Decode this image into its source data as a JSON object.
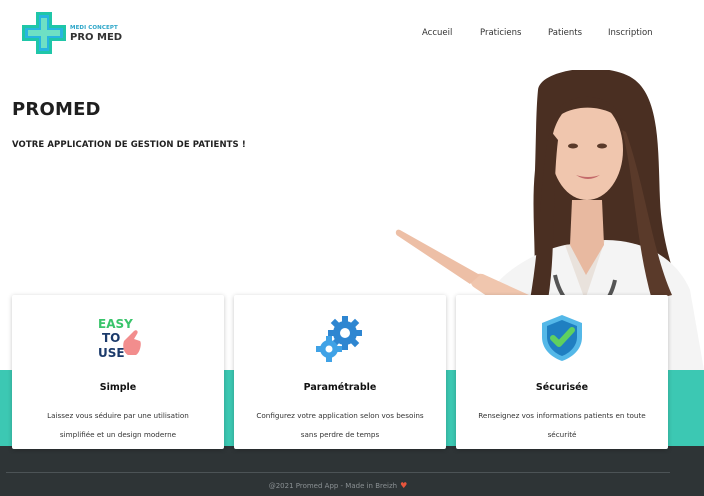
{
  "header": {
    "logo_subtitle": "MEDI CONCEPT",
    "logo_name": "PRO MED",
    "nav": [
      "Accueil",
      "Praticiens",
      "Patients",
      "Inscription"
    ]
  },
  "hero": {
    "title": "PROMED",
    "subtitle": "VOTRE APPLICATION DE GESTION DE PATIENTS !"
  },
  "features": [
    {
      "icon": "easy-to-use-icon",
      "icon_text": [
        "EASY",
        "TO",
        "USE"
      ],
      "title": "Simple",
      "desc_line1": "Laissez vous séduire par une utilisation",
      "desc_line2": "simplifiée et un design moderne"
    },
    {
      "icon": "gears-icon",
      "title": "Paramétrable",
      "desc_line1": "Configurez votre application selon vos besoins",
      "desc_line2": "sans perdre de temps"
    },
    {
      "icon": "shield-check-icon",
      "title": "Sécurisée",
      "desc_line1": "Renseignez vos informations patients en toute",
      "desc_line2": "sécurité"
    }
  ],
  "footer": {
    "text": "@2021 Promed App - Made in Breizh",
    "heart": "♥"
  },
  "colors": {
    "teal": "#3cc8b3",
    "dark": "#2e3436",
    "accent_blue": "#2aa5c8",
    "heart": "#e8553c"
  }
}
